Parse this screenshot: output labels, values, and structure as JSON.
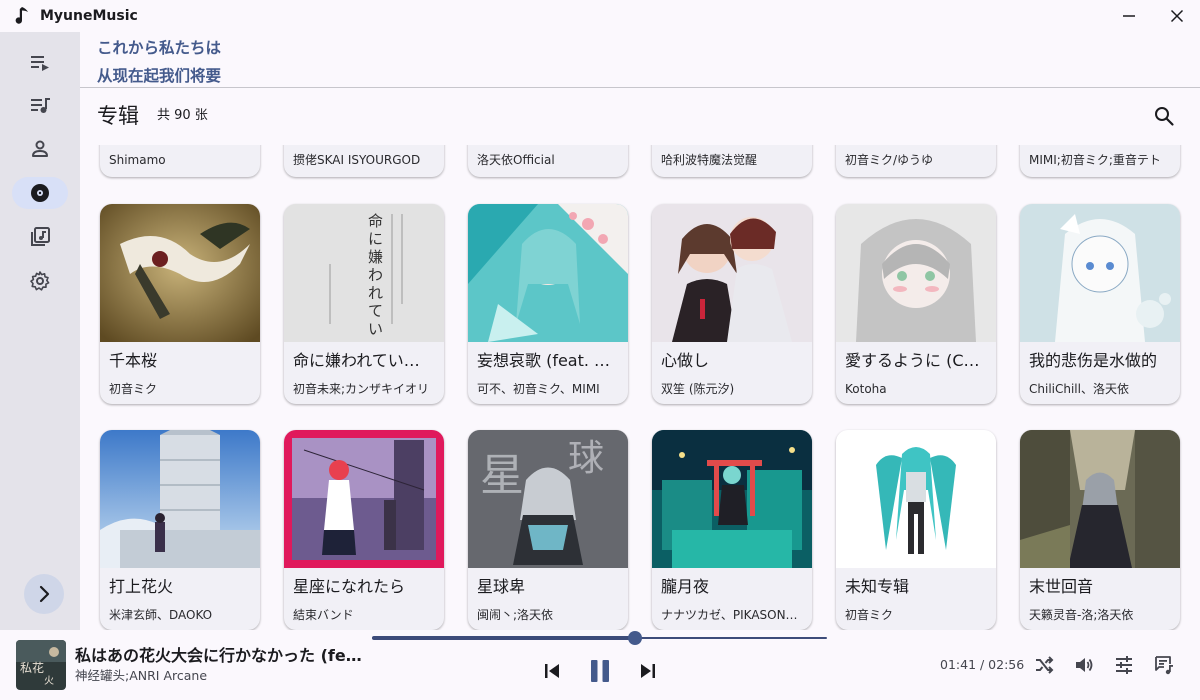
{
  "app": {
    "title": "MyuneMusic"
  },
  "lyrics": {
    "line1": "これから私たちは",
    "line2": "从现在起我们将要"
  },
  "page": {
    "title": "专辑",
    "count": "共 90 张"
  },
  "sidebar": {
    "items": [
      {
        "name": "playlist-queue-icon"
      },
      {
        "name": "song-list-icon"
      },
      {
        "name": "artist-icon"
      },
      {
        "name": "album-icon"
      },
      {
        "name": "library-icon"
      },
      {
        "name": "settings-icon"
      }
    ],
    "active": "album-icon",
    "expand_icon": "chevron-right-icon"
  },
  "partial_row": [
    {
      "artist": "Shimamo"
    },
    {
      "artist": "掼佬SKAI ISYOURGOD"
    },
    {
      "artist": "洛天依Official"
    },
    {
      "artist": "哈利波特魔法觉醒"
    },
    {
      "artist": "初音ミク/ゆうゆ"
    },
    {
      "artist": "MIMI;初音ミク;重音テト"
    }
  ],
  "albums": [
    {
      "title": "千本桜",
      "artist": "初音ミク"
    },
    {
      "title": "命に嫌われてい…",
      "artist": "初音未来;カンザキイオリ"
    },
    {
      "title": "妄想哀歌 (feat. …",
      "artist": "可不、初音ミク、MIMI"
    },
    {
      "title": "心做し",
      "artist": "双笙 (陈元汐)"
    },
    {
      "title": "愛するように (Co…",
      "artist": "Kotoha"
    },
    {
      "title": "我的悲伤是水做的",
      "artist": "ChiliChill、洛天依"
    },
    {
      "title": "打上花火",
      "artist": "米津玄師、DAOKO"
    },
    {
      "title": "星座になれたら",
      "artist": "結束バンド"
    },
    {
      "title": "星球卑",
      "artist": "闽闹丶;洛天依"
    },
    {
      "title": "朧月夜",
      "artist": "ナナツカゼ、PIKASON…"
    },
    {
      "title": "未知专辑",
      "artist": "初音ミク"
    },
    {
      "title": "末世回音",
      "artist": "天籁灵音-洛;洛天依"
    }
  ],
  "player": {
    "title": "私はあの花火大会に行かなかった (fe…",
    "artist": "神经罐头;ANRI Arcane",
    "current_time": "01:41",
    "total_time": "02:56",
    "time_display": "01:41 / 02:56",
    "progress": 0.577,
    "accent": "#445a8c"
  },
  "colors": {
    "sidebar_bg": "#e4e3ea",
    "active_nav": "#d8e0f7",
    "background": "#fbf8fd",
    "card": "#f1f0f6",
    "accent": "#445a8c"
  }
}
